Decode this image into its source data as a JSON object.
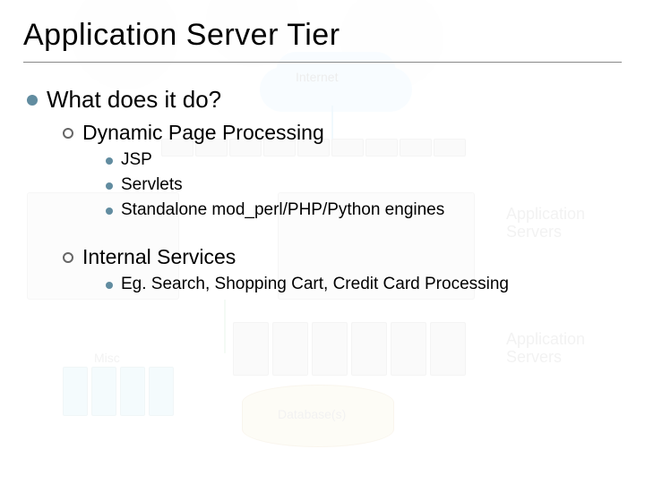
{
  "title": "Application Server Tier",
  "l1": {
    "what": "What does it do?"
  },
  "l2": {
    "dynamic": "Dynamic Page Processing",
    "internal": "Internal Services"
  },
  "l3": {
    "jsp": "JSP",
    "servlets": "Servlets",
    "standalone": "Standalone mod_perl/PHP/Python engines",
    "eg": "Eg. Search, Shopping Cart, Credit Card Processing"
  },
  "bg": {
    "internet": "Internet",
    "app_servers": "Application\nServers",
    "misc": "Misc",
    "databases": "Database(s)"
  }
}
